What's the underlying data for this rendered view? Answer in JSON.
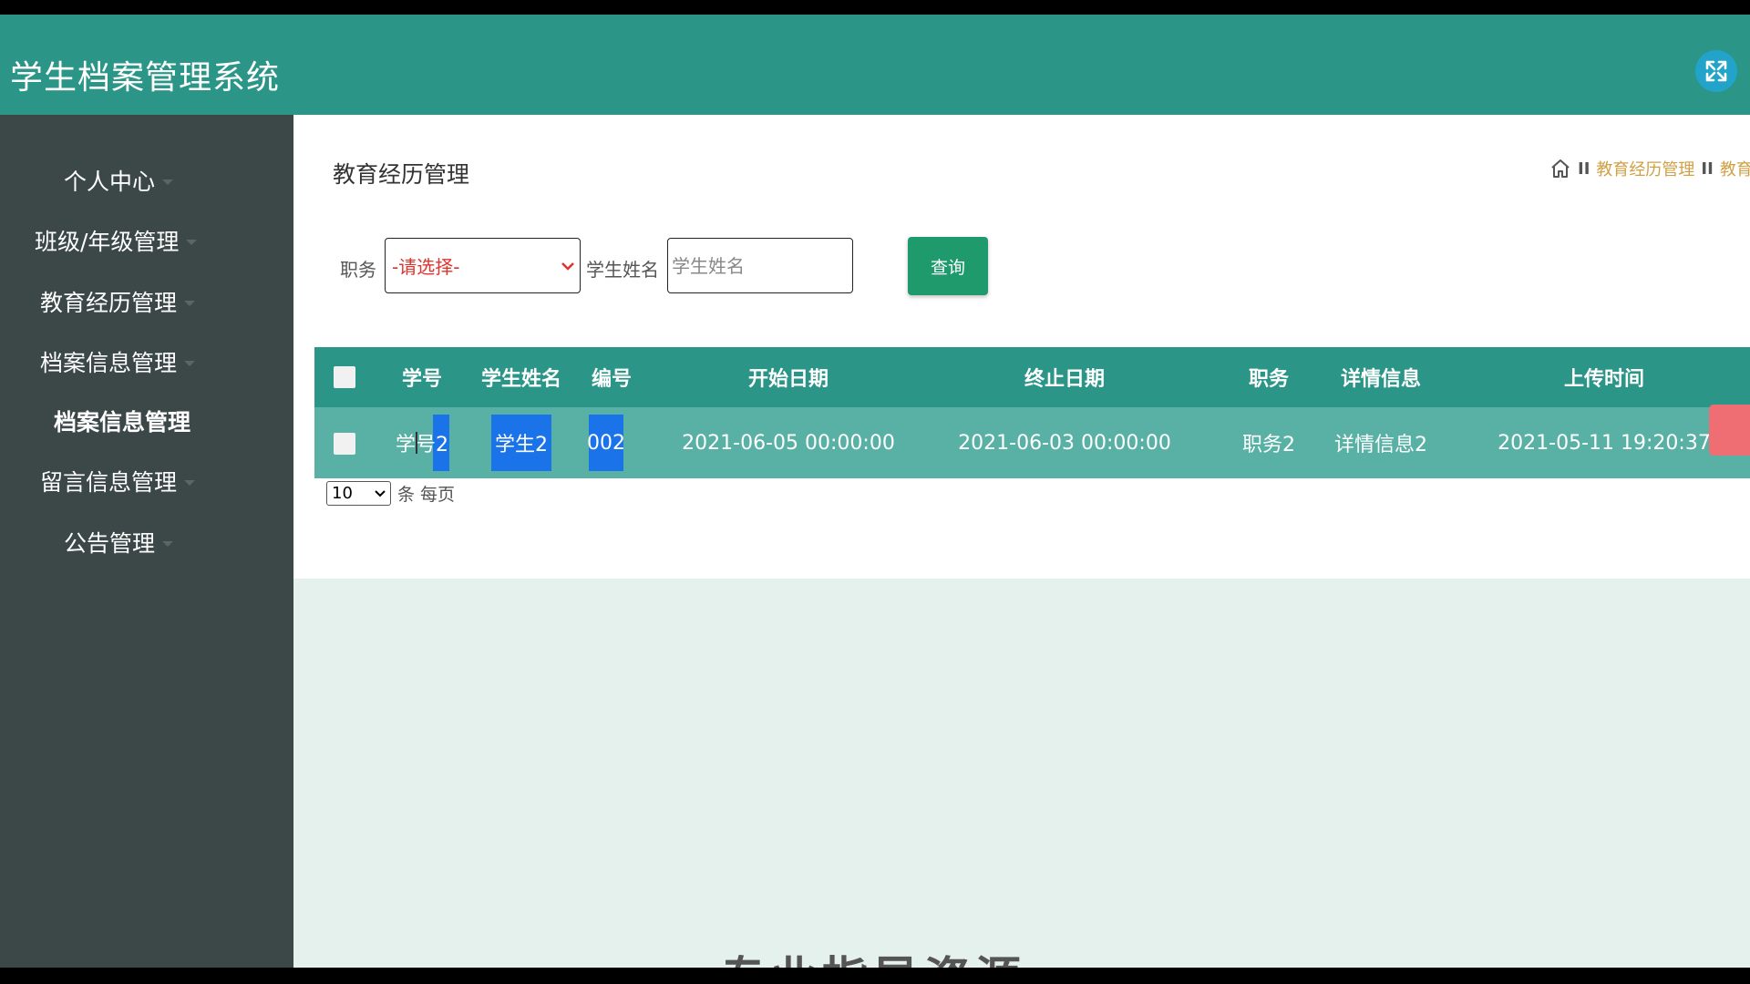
{
  "app": {
    "title": "学生档案管理系统"
  },
  "sidebar": {
    "items": [
      {
        "label": "个人中心"
      },
      {
        "label": "班级/年级管理"
      },
      {
        "label": "教育经历管理"
      },
      {
        "label": "档案信息管理"
      },
      {
        "label": "档案信息管理"
      },
      {
        "label": "留言信息管理"
      },
      {
        "label": "公告管理"
      }
    ]
  },
  "page": {
    "title": "教育经历管理"
  },
  "breadcrumb": {
    "sep": "II",
    "items": [
      "教育经历管理",
      "教育"
    ]
  },
  "filters": {
    "role_label": "职务",
    "role_value": "-请选择-",
    "name_label": "学生姓名",
    "name_placeholder": "学生姓名",
    "search_label": "查询"
  },
  "table": {
    "columns": [
      "学号",
      "学生姓名",
      "编号",
      "开始日期",
      "终止日期",
      "职务",
      "详情信息",
      "上传时间"
    ],
    "rows": [
      [
        "学号2",
        "学生2",
        "002",
        "2021-06-05 00:00:00",
        "2021-06-03 00:00:00",
        "职务2",
        "详情信息2",
        "2021-05-11 19:20:37"
      ]
    ]
  },
  "pagination": {
    "page_size": "10",
    "suffix": "条 每页"
  },
  "footer": {
    "partial_text": "专业指导资源"
  },
  "colors": {
    "topbar": "#2b9687",
    "sidebar": "#3c4848",
    "accent": "#1e9a6c",
    "link": "#d1a044"
  }
}
